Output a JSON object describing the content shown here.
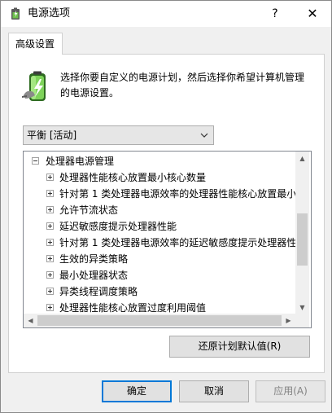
{
  "window": {
    "title": "电源选项",
    "help_label": "?",
    "close_label": "✕"
  },
  "tab": {
    "label": "高级设置"
  },
  "description": "选择你要自定义的电源计划，然后选择你希望计算机管理的电源设置。",
  "plan_select": {
    "value": "平衡 [活动]"
  },
  "tree": {
    "root": "处理器电源管理",
    "items": [
      "处理器性能核心放置最小核心数量",
      "针对第 1 类处理器电源效率的处理器性能核心放置最小",
      "允许节流状态",
      "延迟敏感度提示处理器性能",
      "针对第 1 类处理器电源效率的延迟敏感度提示处理器性",
      "生效的异类策略",
      "最小处理器状态",
      "异类线程调度策略",
      "处理器性能核心放置过度利用阈值"
    ]
  },
  "buttons": {
    "restore": "还原计划默认值(R)",
    "ok": "确定",
    "cancel": "取消",
    "apply": "应用(A)"
  },
  "colors": {
    "accent": "#0078d7",
    "battery_green": "#3fae2a"
  }
}
